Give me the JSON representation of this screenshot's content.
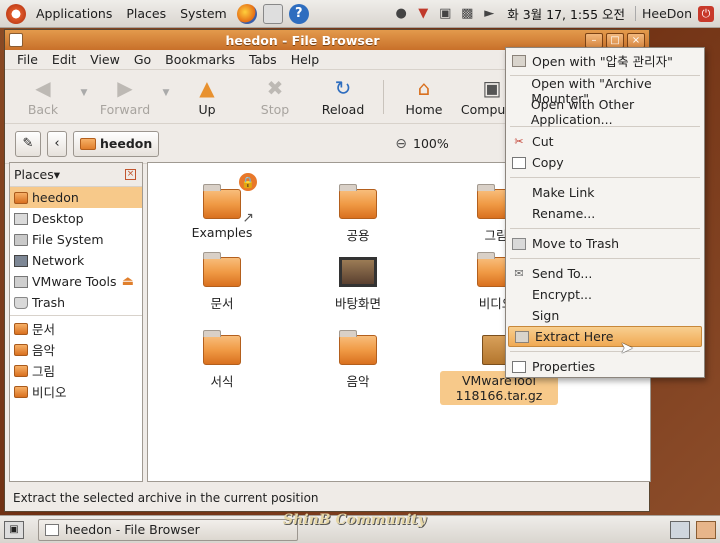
{
  "top_panel": {
    "menus": [
      "Applications",
      "Places",
      "System"
    ],
    "clock": "화 3월 17, 1:55 오전",
    "user": "HeeDon"
  },
  "window": {
    "title": "heedon - File Browser",
    "menu": [
      "File",
      "Edit",
      "View",
      "Go",
      "Bookmarks",
      "Tabs",
      "Help"
    ],
    "toolbar": {
      "back": "Back",
      "forward": "Forward",
      "up": "Up",
      "stop": "Stop",
      "reload": "Reload",
      "home": "Home",
      "computer": "Computer"
    },
    "location": {
      "crumb": "heedon",
      "zoom": "100%"
    },
    "sidebar": {
      "header": "Places",
      "items": [
        "heedon",
        "Desktop",
        "File System",
        "Network",
        "VMware Tools",
        "Trash"
      ],
      "bookmarks": [
        "문서",
        "음악",
        "그림",
        "비디오"
      ]
    },
    "files": [
      {
        "name": "Examples"
      },
      {
        "name": "공용"
      },
      {
        "name": "그림"
      },
      {
        "name": "문서"
      },
      {
        "name": "바탕화면"
      },
      {
        "name": "비디오"
      },
      {
        "name": "서식"
      },
      {
        "name": "음악"
      },
      {
        "name": "VMwareTool",
        "name2": "118166.tar.gz"
      }
    ],
    "status": "Extract the selected archive in the current position"
  },
  "context_menu": {
    "items": [
      "Open with \"압축 관리자\"",
      "Open with \"Archive Mounter\"",
      "Open with Other Application...",
      "Cut",
      "Copy",
      "Make Link",
      "Rename...",
      "Move to Trash",
      "Send To...",
      "Encrypt...",
      "Sign",
      "Extract Here",
      "Properties"
    ]
  },
  "bottom_panel": {
    "task": "heedon - File Browser",
    "watermark": "ShinB Community"
  }
}
